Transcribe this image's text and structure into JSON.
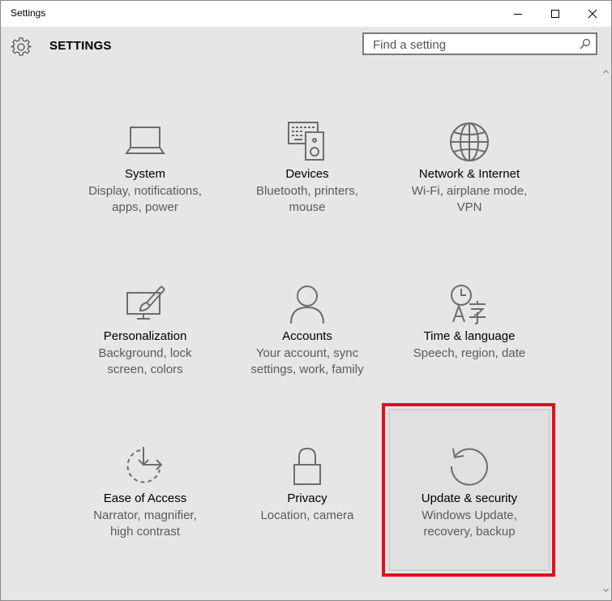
{
  "window": {
    "title": "Settings"
  },
  "header": {
    "title": "SETTINGS"
  },
  "search": {
    "placeholder": "Find a setting"
  },
  "tiles": [
    {
      "name": "System",
      "desc_line1": "Display, notifications,",
      "desc_line2": "apps, power",
      "icon": "laptop-icon"
    },
    {
      "name": "Devices",
      "desc_line1": "Bluetooth, printers,",
      "desc_line2": "mouse",
      "icon": "devices-icon"
    },
    {
      "name": "Network & Internet",
      "desc_line1": "Wi-Fi, airplane mode,",
      "desc_line2": "VPN",
      "icon": "globe-icon"
    },
    {
      "name": "Personalization",
      "desc_line1": "Background, lock",
      "desc_line2": "screen, colors",
      "icon": "personalization-icon"
    },
    {
      "name": "Accounts",
      "desc_line1": "Your account, sync",
      "desc_line2": "settings, work, family",
      "icon": "person-icon"
    },
    {
      "name": "Time & language",
      "desc_line1": "Speech, region, date",
      "desc_line2": "",
      "icon": "time-language-icon"
    },
    {
      "name": "Ease of Access",
      "desc_line1": "Narrator, magnifier,",
      "desc_line2": "high contrast",
      "icon": "ease-of-access-icon"
    },
    {
      "name": "Privacy",
      "desc_line1": "Location, camera",
      "desc_line2": "",
      "icon": "lock-icon"
    },
    {
      "name": "Update & security",
      "desc_line1": "Windows Update,",
      "desc_line2": "recovery, backup",
      "icon": "refresh-icon"
    }
  ],
  "colors": {
    "highlight": "#e0101e",
    "icon": "#6d6d6d",
    "background": "#e6e6e6"
  }
}
